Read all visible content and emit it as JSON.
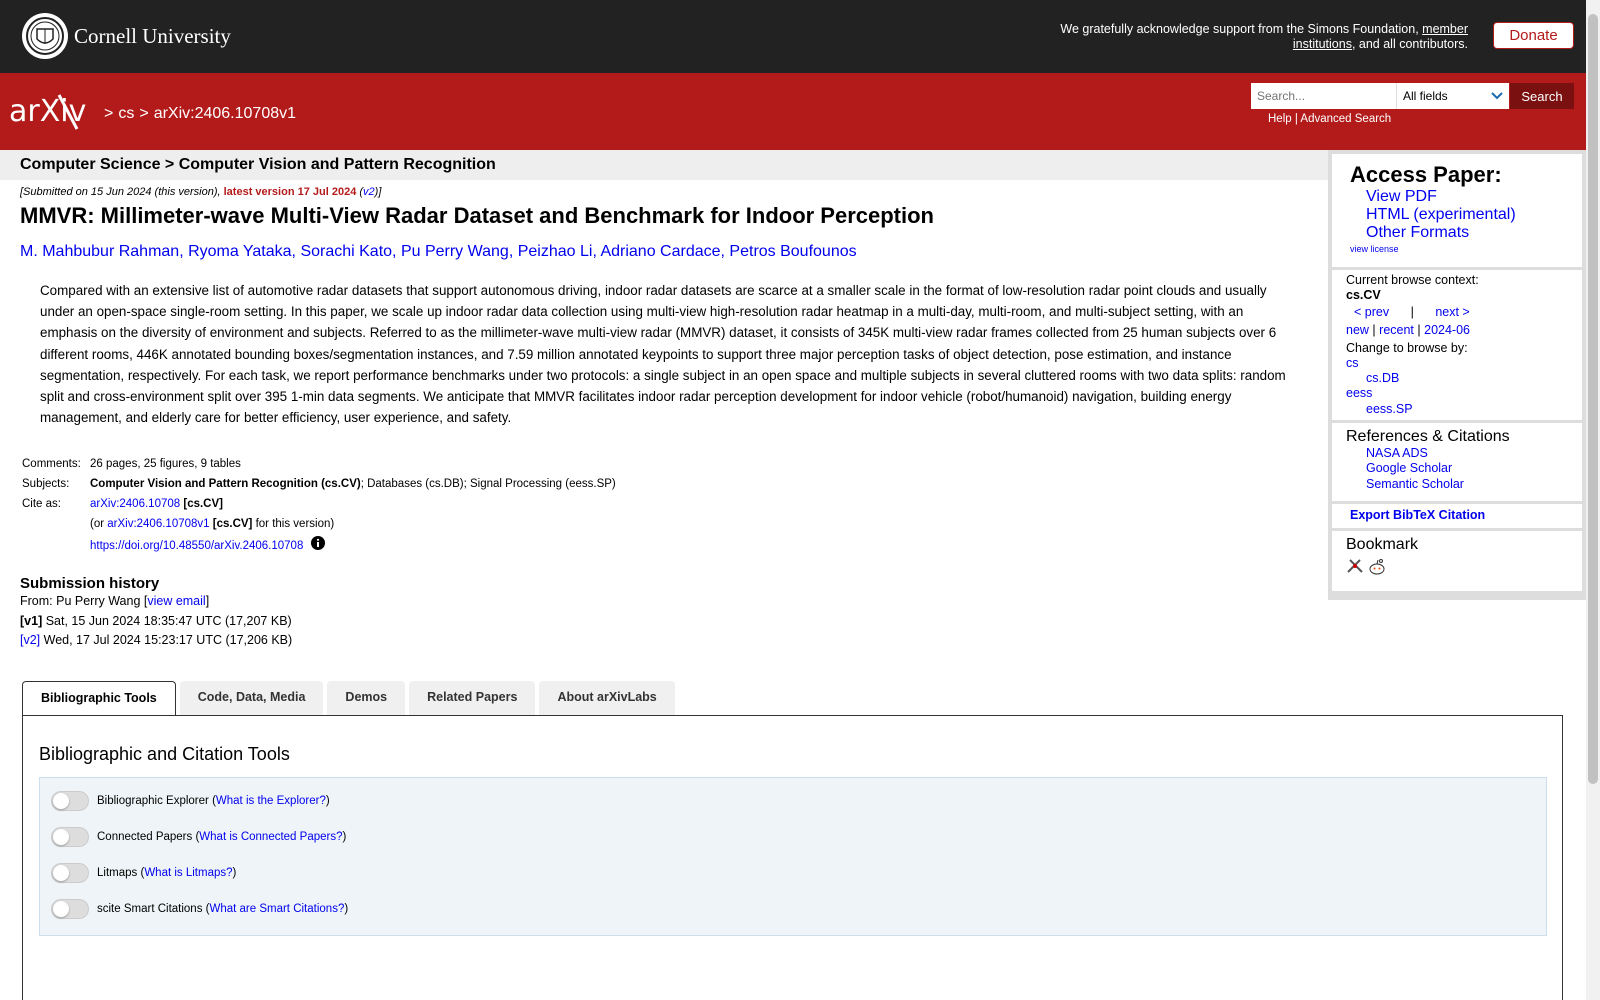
{
  "cornell": {
    "name": "Cornell University",
    "support_text_prefix": "We gratefully acknowledge support from the Simons Foundation, ",
    "support_link": "member institutions",
    "support_text_suffix": ", and all contributors.",
    "donate_label": "Donate"
  },
  "header": {
    "logo_text": "arXiv",
    "breadcrumb": [
      ">",
      "cs",
      ">",
      "arXiv:2406.10708v1"
    ],
    "search_placeholder": "Search...",
    "field_select": "All fields",
    "search_label": "Search",
    "help_label": "Help",
    "separator": "|",
    "advanced_label": "Advanced Search"
  },
  "subject_bar": "Computer Science > Computer Vision and Pattern Recognition",
  "dateline": {
    "prefix": "[Submitted on 15 Jun 2024 (this version), ",
    "latest": "latest version 17 Jul 2024",
    "v_open": " (",
    "v_link": "v2",
    "v_close": ")]"
  },
  "title": "MMVR: Millimeter-wave Multi-View Radar Dataset and Benchmark for Indoor Perception",
  "authors": [
    "M. Mahbubur Rahman",
    "Ryoma Yataka",
    "Sorachi Kato",
    "Pu Perry Wang",
    "Peizhao Li",
    "Adriano Cardace",
    "Petros Boufounos"
  ],
  "abstract": "Compared with an extensive list of automotive radar datasets that support autonomous driving, indoor radar datasets are scarce at a smaller scale in the format of low-resolution radar point clouds and usually under an open-space single-room setting. In this paper, we scale up indoor radar data collection using multi-view high-resolution radar heatmap in a multi-day, multi-room, and multi-subject setting, with an emphasis on the diversity of environment and subjects. Referred to as the millimeter-wave multi-view radar (MMVR) dataset, it consists of 345K multi-view radar frames collected from 25 human subjects over 6 different rooms, 446K annotated bounding boxes/segmentation instances, and 7.59 million annotated keypoints to support three major perception tasks of object detection, pose estimation, and instance segmentation, respectively. For each task, we report performance benchmarks under two protocols: a single subject in an open space and multiple subjects in several cluttered rooms with two data splits: random split and cross-environment split over 395 1-min data segments. We anticipate that MMVR facilitates indoor radar perception development for indoor vehicle (robot/humanoid) navigation, building energy management, and elderly care for better efficiency, user experience, and safety.",
  "meta": {
    "comments_label": "Comments:",
    "comments": "26 pages, 25 figures, 9 tables",
    "subjects_label": "Subjects:",
    "subjects_primary": "Computer Vision and Pattern Recognition (cs.CV)",
    "subjects_rest": "; Databases (cs.DB); Signal Processing (eess.SP)",
    "cite_label": "Cite as:",
    "cite_id": "arXiv:2406.10708",
    "cite_cat": "[cs.CV]",
    "or_prefix": "(or ",
    "version_id": "arXiv:2406.10708v1",
    "version_cat": "[cs.CV]",
    "version_suffix": " for this version)",
    "doi": "https://doi.org/10.48550/arXiv.2406.10708"
  },
  "history": {
    "title": "Submission history",
    "from_prefix": "From: Pu Perry Wang [",
    "view_email": "view email",
    "from_suffix": "]",
    "v1_label": "[v1]",
    "v1_text": " Sat, 15 Jun 2024 18:35:47 UTC (17,207 KB)",
    "v2_label": "[v2]",
    "v2_text": " Wed, 17 Jul 2024 15:23:17 UTC (17,206 KB)"
  },
  "sidebar": {
    "access_title": "Access Paper:",
    "access_links": [
      "View PDF",
      "HTML (experimental)",
      "Other Formats"
    ],
    "view_license": "view license",
    "context_label": "Current browse context:",
    "context_value": "cs.CV",
    "prev": "< prev",
    "pipe": "|",
    "next": "next >",
    "new": "new",
    "recent": "recent",
    "month": "2024-06",
    "change_label": "Change to browse by:",
    "browse_cs": "cs",
    "browse_csdb": "cs.DB",
    "browse_eess": "eess",
    "browse_eesssp": "eess.SP",
    "refs_title": "References & Citations",
    "refs": [
      "NASA ADS",
      "Google Scholar",
      "Semantic Scholar"
    ],
    "export": "Export BibTeX Citation",
    "bookmark_title": "Bookmark"
  },
  "tabs": [
    "Bibliographic Tools",
    "Code, Data, Media",
    "Demos",
    "Related Papers",
    "About arXivLabs"
  ],
  "panel": {
    "title": "Bibliographic and Citation Tools",
    "tools": [
      {
        "name": "Bibliographic Explorer",
        "link": "What is the Explorer?"
      },
      {
        "name": "Connected Papers",
        "link": "What is Connected Papers?"
      },
      {
        "name": "Litmaps",
        "link": "What is Litmaps?"
      },
      {
        "name": "scite Smart Citations",
        "link": "What are Smart Citations?"
      }
    ]
  },
  "colors": {
    "arxiv_red": "#b31b1b",
    "cornell_dark": "#222222",
    "link_blue": "#0000ee"
  }
}
